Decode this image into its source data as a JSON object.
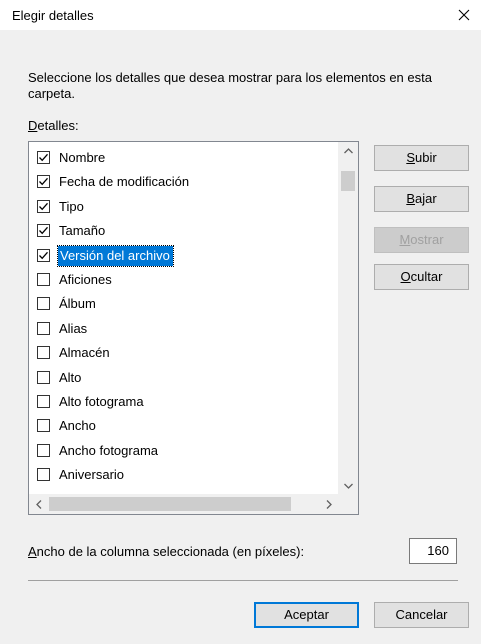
{
  "window": {
    "title": "Elegir detalles"
  },
  "description": "Seleccione los detalles que desea mostrar para los elementos en esta carpeta.",
  "details_label": {
    "accel": "D",
    "rest": "etalles:"
  },
  "items": [
    {
      "label": "Nombre",
      "checked": true
    },
    {
      "label": "Fecha de modificación",
      "checked": true
    },
    {
      "label": "Tipo",
      "checked": true
    },
    {
      "label": "Tamaño",
      "checked": true
    },
    {
      "label": "Versión del archivo",
      "checked": true,
      "selected": true
    },
    {
      "label": "Aficiones",
      "checked": false
    },
    {
      "label": "Álbum",
      "checked": false
    },
    {
      "label": "Alias",
      "checked": false
    },
    {
      "label": "Almacén",
      "checked": false
    },
    {
      "label": "Alto",
      "checked": false
    },
    {
      "label": "Alto fotograma",
      "checked": false
    },
    {
      "label": "Ancho",
      "checked": false
    },
    {
      "label": "Ancho fotograma",
      "checked": false
    },
    {
      "label": "Aniversario",
      "checked": false
    }
  ],
  "buttons": {
    "up": {
      "accel": "S",
      "rest": "ubir"
    },
    "down": {
      "accel": "B",
      "rest": "ajar"
    },
    "show": {
      "accel": "M",
      "rest": "ostrar"
    },
    "hide": {
      "accel": "O",
      "rest": "cultar"
    },
    "ok": "Aceptar",
    "cancel": "Cancelar"
  },
  "column_width": {
    "label_accel": "A",
    "label_rest": "ncho de la columna seleccionada (en píxeles):",
    "value": "160"
  },
  "colors": {
    "accent": "#0078d7"
  }
}
